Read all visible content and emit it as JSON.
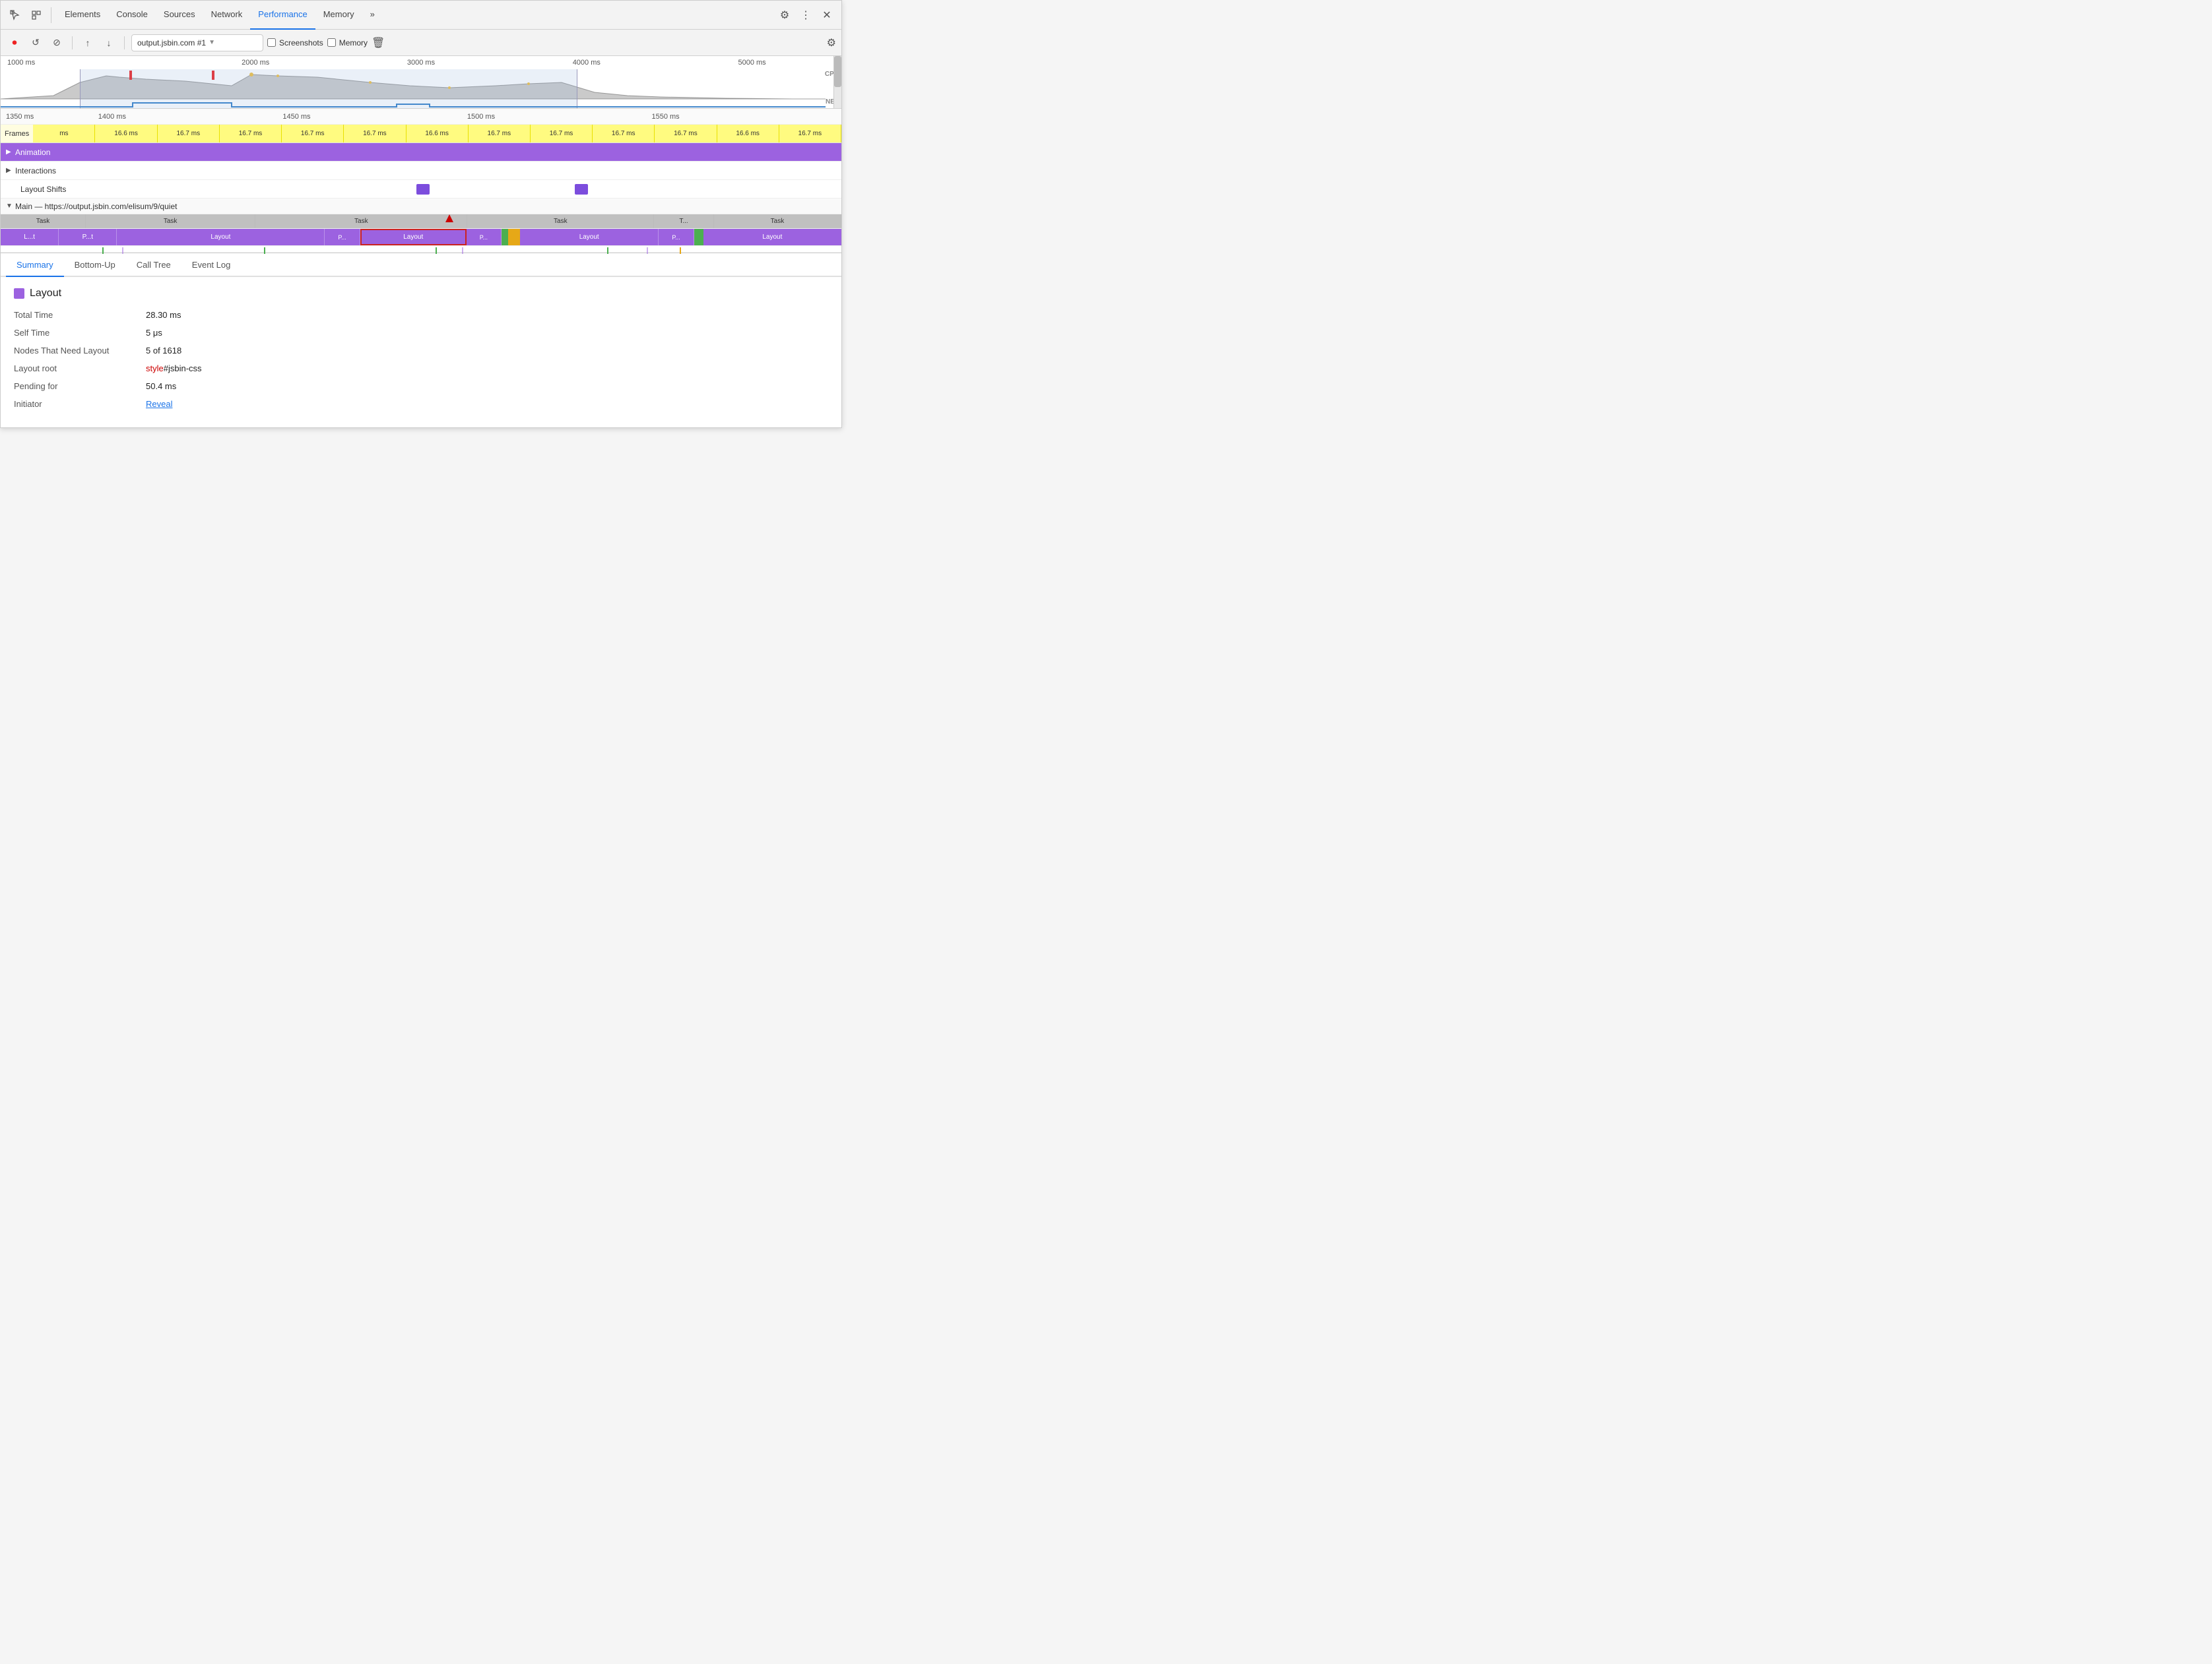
{
  "tabs": [
    {
      "id": "elements",
      "label": "Elements",
      "active": false
    },
    {
      "id": "console",
      "label": "Console",
      "active": false
    },
    {
      "id": "sources",
      "label": "Sources",
      "active": false
    },
    {
      "id": "network",
      "label": "Network",
      "active": false
    },
    {
      "id": "performance",
      "label": "Performance",
      "active": true
    },
    {
      "id": "memory",
      "label": "Memory",
      "active": false
    }
  ],
  "toolbar": {
    "url": "output.jsbin.com #1",
    "screenshots_label": "Screenshots",
    "memory_label": "Memory"
  },
  "overview": {
    "ticks": [
      "1000 ms",
      "2000 ms",
      "3000 ms",
      "4000 ms",
      "5000 ms"
    ],
    "cpu_label": "CPU",
    "net_label": "NET"
  },
  "timeline": {
    "ticks": [
      "1350 ms",
      "1400 ms",
      "1450 ms",
      "1500 ms",
      "1550 ms"
    ],
    "frames": [
      "ms",
      "16.6 ms",
      "16.7 ms",
      "16.7 ms",
      "16.7 ms",
      "16.7 ms",
      "16.6 ms",
      "16.7 ms",
      "16.7 ms",
      "16.7 ms",
      "16.7 ms",
      "16.6 ms",
      "16.7 ms"
    ],
    "animation_label": "Animation",
    "interactions_label": "Interactions",
    "layout_shifts_label": "Layout Shifts",
    "main_label": "Main — https://output.jsbin.com/elisum/9/quiet",
    "tasks": [
      "Task",
      "Task",
      "Task",
      "Task",
      "T...",
      "Task"
    ],
    "flame_items": [
      "L...t",
      "P...t",
      "Layout",
      "P...",
      "Layout",
      "P...",
      "Layout",
      "P...",
      "Layout"
    ]
  },
  "bottom_tabs": [
    {
      "id": "summary",
      "label": "Summary",
      "active": true
    },
    {
      "id": "bottom-up",
      "label": "Bottom-Up",
      "active": false
    },
    {
      "id": "call-tree",
      "label": "Call Tree",
      "active": false
    },
    {
      "id": "event-log",
      "label": "Event Log",
      "active": false
    }
  ],
  "summary": {
    "title": "Layout",
    "color": "#9c62e0",
    "rows": [
      {
        "key": "Total Time",
        "value": "28.30 ms",
        "type": "text"
      },
      {
        "key": "Self Time",
        "value": "5 μs",
        "type": "text"
      },
      {
        "key": "Nodes That Need Layout",
        "value": "5 of 1618",
        "type": "text"
      },
      {
        "key": "Layout root",
        "value_parts": [
          {
            "text": "style",
            "class": "style-text"
          },
          {
            "text": "#jsbin-css",
            "class": "id-text"
          }
        ],
        "type": "mixed"
      },
      {
        "key": "Pending for",
        "value": "50.4 ms",
        "type": "text"
      },
      {
        "key": "Initiator",
        "value": "Reveal",
        "type": "link"
      }
    ]
  }
}
